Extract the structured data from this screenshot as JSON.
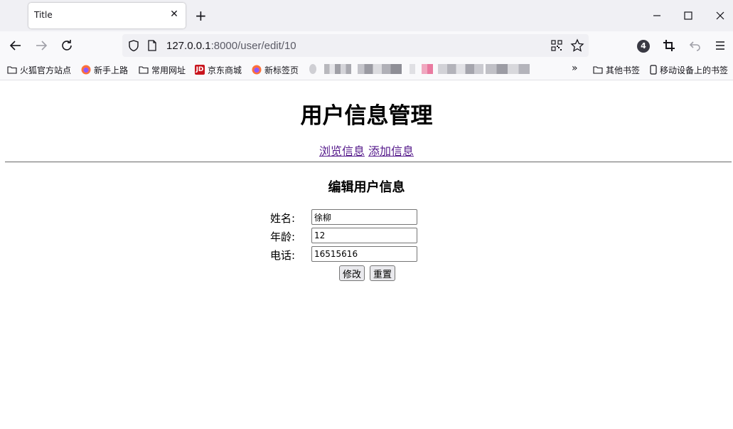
{
  "browser": {
    "tab": {
      "title": "Title",
      "close_icon": "close-icon"
    },
    "url": {
      "host": "127.0.0.1",
      "path": ":8000/user/edit/10"
    },
    "extension_badge": "4",
    "bookmarks": [
      {
        "label": "火狐官方站点",
        "icon": "folder-icon"
      },
      {
        "label": "新手上路",
        "icon": "firefox-icon"
      },
      {
        "label": "常用网址",
        "icon": "folder-icon"
      },
      {
        "label": "京东商城",
        "icon": "jd-icon"
      },
      {
        "label": "新标签页",
        "icon": "firefox-icon"
      }
    ],
    "bookmarks_right": [
      {
        "label": "其他书签",
        "icon": "folder-icon"
      },
      {
        "label": "移动设备上的书签",
        "icon": "mobile-icon"
      }
    ]
  },
  "page": {
    "title": "用户信息管理",
    "nav": {
      "browse": "浏览信息",
      "add": "添加信息"
    },
    "form_title": "编辑用户信息",
    "form": {
      "name_label": "姓名:",
      "name_value": "徐柳",
      "age_label": "年龄:",
      "age_value": "12",
      "phone_label": "电话:",
      "phone_value": "16515616",
      "submit_label": "修改",
      "reset_label": "重置"
    }
  },
  "colors": {
    "link_visited": "#551a8b",
    "chrome_bg": "#f0f0f4",
    "toolbar_bg": "#f9f9fb"
  }
}
